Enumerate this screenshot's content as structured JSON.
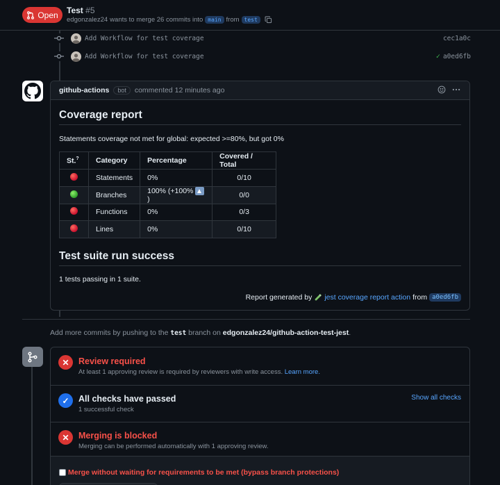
{
  "header": {
    "status_label": "Open",
    "title": "Test",
    "number": "#5",
    "author": "edgonzalez24",
    "merge_text": "wants to merge 26 commits into",
    "base_branch": "main",
    "from_text": "from",
    "head_branch": "test"
  },
  "commits": [
    {
      "message": "Add Workflow for test coverage",
      "sha": "cec1a0c"
    },
    {
      "message": "Add Workflow for test coverage",
      "sha": "a0ed6fb"
    }
  ],
  "comment": {
    "author": "github-actions",
    "badge": "bot",
    "meta": "commented 12 minutes ago",
    "coverage_title": "Coverage report",
    "coverage_msg": "Statements coverage not met for global: expected >=80%, but got 0%",
    "table": {
      "headers": [
        "St.",
        "Category",
        "Percentage",
        "Covered / Total"
      ],
      "header_note": "?",
      "rows": [
        {
          "status": "red",
          "category": "Statements",
          "percentage": "0%",
          "covered": "0/10"
        },
        {
          "status": "green",
          "category": "Branches",
          "percentage": "100% (+100%",
          "covered": "0/0"
        },
        {
          "status": "red",
          "category": "Functions",
          "percentage": "0%",
          "covered": "0/3"
        },
        {
          "status": "red",
          "category": "Lines",
          "percentage": "0%",
          "covered": "0/10"
        }
      ],
      "branches_suffix": ")"
    },
    "suite_title": "Test suite run success",
    "suite_msg": "1 tests passing in 1 suite.",
    "report_prefix": "Report generated by",
    "report_link": "jest coverage report action",
    "report_from": "from",
    "report_sha": "a0ed6fb"
  },
  "push_hint": {
    "prefix": "Add more commits by pushing to the",
    "branch": "test",
    "middle": "branch on",
    "repo": "edgonzalez24/github-action-test-jest",
    "suffix": "."
  },
  "merge": {
    "review": {
      "title": "Review required",
      "desc": "At least 1 approving review is required by reviewers with write access.",
      "link": "Learn more."
    },
    "checks": {
      "title": "All checks have passed",
      "desc": "1 successful check",
      "link": "Show all checks"
    },
    "blocked": {
      "title": "Merging is blocked",
      "desc": "Merging can be performed automatically with 1 approving review."
    },
    "bypass": "Merge without waiting for requirements to be met (bypass branch protections)"
  },
  "colors": {
    "open": "#da3633",
    "link": "#58a6ff",
    "error": "#f85149",
    "success": "#3fb950"
  }
}
